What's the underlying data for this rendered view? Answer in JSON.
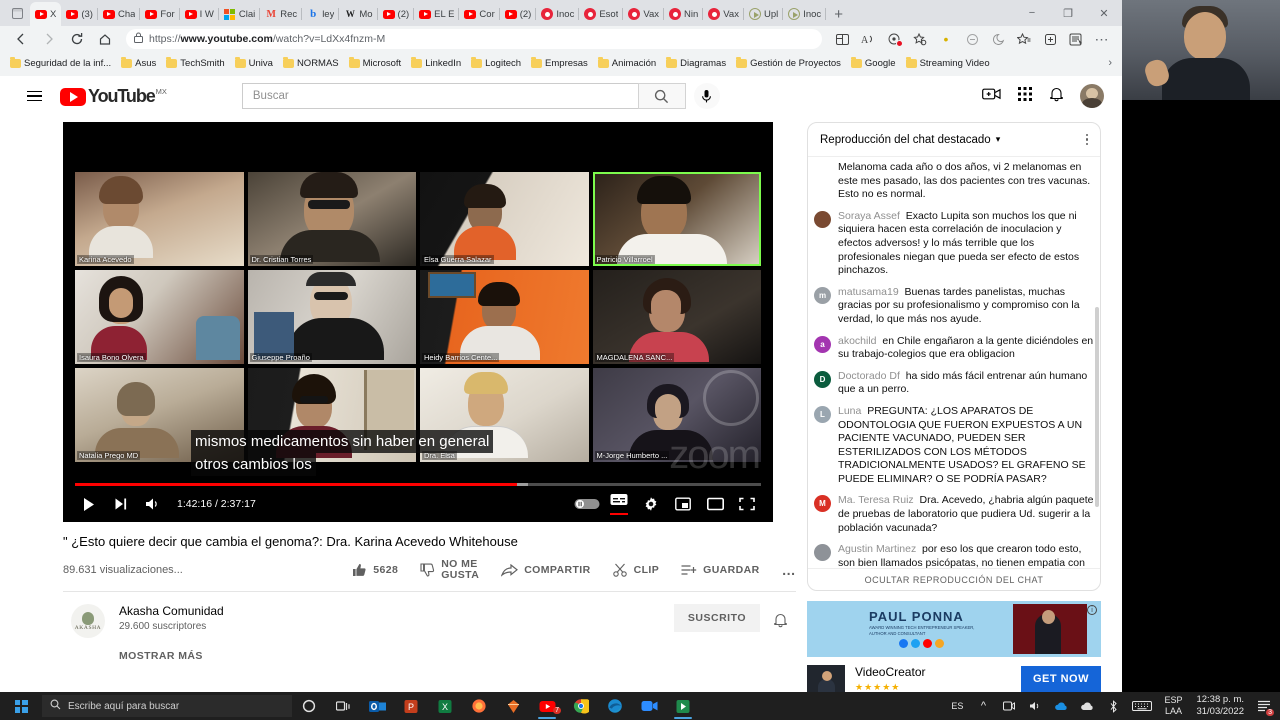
{
  "browser": {
    "tabs": [
      {
        "label": "X",
        "icon": "youtube-icon",
        "active": true
      },
      {
        "label": "(3) ",
        "icon": "youtube-icon"
      },
      {
        "label": "Cha",
        "icon": "youtube-icon"
      },
      {
        "label": "For",
        "icon": "youtube-icon"
      },
      {
        "label": "I W",
        "icon": "youtube-icon"
      },
      {
        "label": "Clai",
        "icon": "microsoft-icon"
      },
      {
        "label": "Rec",
        "icon": "gmail-icon"
      },
      {
        "label": "ley ",
        "icon": "bing-icon"
      },
      {
        "label": "Mo",
        "icon": "wikipedia-icon"
      },
      {
        "label": "(2) ",
        "icon": "youtube-icon"
      },
      {
        "label": "EL E",
        "icon": "youtube-icon"
      },
      {
        "label": "Cor",
        "icon": "youtube-icon"
      },
      {
        "label": "(2) ",
        "icon": "youtube-icon"
      },
      {
        "label": "Inoc",
        "icon": "virus-icon"
      },
      {
        "label": "Esot",
        "icon": "virus-icon"
      },
      {
        "label": "Vax",
        "icon": "virus-icon"
      },
      {
        "label": "Nin",
        "icon": "virus-icon"
      },
      {
        "label": "Vax",
        "icon": "virus-icon"
      },
      {
        "label": "Upl",
        "icon": "play-circle-icon"
      },
      {
        "label": "Inoc",
        "icon": "play-circle-icon"
      }
    ],
    "new_tab_label": "+",
    "window_controls": {
      "minimize": "−",
      "maximize": "❐",
      "close": "✕"
    },
    "url_secure": "https://",
    "url_domain": "www.youtube.com",
    "url_path": "/watch?v=LdXx4fnzm-M",
    "bookmarks": [
      "Seguridad de la inf...",
      "Asus",
      "TechSmith",
      "Univa",
      "NORMAS",
      "Microsoft",
      "LinkedIn",
      "Logitech",
      "Empresas",
      "Animación",
      "Diagramas",
      "Gestión de Proyectos",
      "Google",
      "Streaming Video"
    ],
    "bookmarks_overflow": "›"
  },
  "youtube": {
    "logo_text": "YouTube",
    "logo_country": "MX",
    "search_placeholder": "Buscar",
    "video": {
      "title": "\" ¿Esto quiere decir que cambia el genoma?: Dra. Karina Acevedo Whitehouse",
      "views": "89.631 visualizaciones...",
      "likes": "5628",
      "dislike_label_1": "NO ME",
      "dislike_label_2": "GUSTA",
      "share_label": "COMPARTIR",
      "clip_label": "CLIP",
      "save_label": "GUARDAR",
      "more_label": "…",
      "current_time": "1:42:16",
      "total_time": "2:37:17",
      "time_display": "1:42:16 / 2:37:17",
      "caption_line_1": "mismos medicamentos sin haber en general",
      "caption_line_2": "otros cambios los",
      "watermark": "zoom",
      "progress_percent": 64.5,
      "participants": [
        {
          "name": "Karina Acevedo",
          "active": false
        },
        {
          "name": "Dr. Cristian Torres",
          "active": false
        },
        {
          "name": "Elsa Guerra Salazar",
          "active": false
        },
        {
          "name": "Patricio Villarroel",
          "active": true
        },
        {
          "name": "Isaura Bono Olvera",
          "active": false
        },
        {
          "name": "Giuseppe Proaño",
          "active": false
        },
        {
          "name": "Heidy Barrios Cente...",
          "active": false
        },
        {
          "name": "MAGDALENA SANC...",
          "active": false
        },
        {
          "name": "Natalia Prego MD",
          "active": false
        },
        {
          "name": "",
          "active": false
        },
        {
          "name": "Dra. Elsa",
          "active": false
        },
        {
          "name": "M-Jorge Humberto ...",
          "active": false
        }
      ]
    },
    "channel": {
      "name": "Akasha Comunidad",
      "avatar_text": "AKASHA",
      "subscribers": "29.600 suscriptores",
      "subscribe_label": "SUSCRITO",
      "show_more_label": "MOSTRAR MÁS"
    },
    "chat": {
      "header": "Reproducción del chat destacado",
      "footer": "OCULTAR REPRODUCCIÓN DEL CHAT",
      "partial_top": "Melanoma cada año o dos años, vi 2 melanomas en este mes pasado, las dos pacientes con tres vacunas. Esto no es normal.",
      "messages": [
        {
          "author": "Soraya Assef",
          "text": "Exacto Lupita son muchos los que ni siquiera hacen esta correlación de inoculacion y efectos adversos! y lo más terrible que los profesionales niegan que pueda ser efecto de estos pinchazos.",
          "initial": "",
          "color": "#7a4a32"
        },
        {
          "author": "matusama19",
          "text": "Buenas tardes panelistas, muchas gracias por su profesionalismo y compromiso con la verdad, lo que más nos ayude.",
          "initial": "m",
          "color": "#9aa0a6"
        },
        {
          "author": "akochild",
          "text": "en Chile engañaron a la gente diciéndoles en su trabajo-colegios que era obligacion",
          "initial": "a",
          "color": "#a335b0"
        },
        {
          "author": "Doctorado Df",
          "text": "ha sido más fácil entrenar aún humano que a un perro.",
          "initial": "D",
          "color": "#0b5c3e"
        },
        {
          "author": "Luna",
          "text": "PREGUNTA: ¿LOS APARATOS DE ODONTOLOGIA QUE FUERON EXPUESTOS A UN PACIENTE VACUNADO, PUEDEN SER ESTERILIZADOS CON LOS MÉTODOS TRADICIONALMENTE USADOS? EL GRAFENO SE PUEDE ELIMINAR? O SE PODRÍA PASAR?",
          "initial": "L",
          "color": "#9aa6b0"
        },
        {
          "author": "Ma. Teresa Ruiz",
          "text": "Dra. Acevedo, ¿habria algún paquete de pruebas de laboratorio que pudiera Ud. sugerir a la población vacunada?",
          "initial": "M",
          "color": "#d93025"
        },
        {
          "author": "Agustin Martinez",
          "text": "por eso los que crearon todo esto, son bien llamados psicópatas, no tienen empatia con ninguna persona",
          "initial": "",
          "color": "#5f6368"
        }
      ]
    },
    "ad": {
      "banner_name": "PAUL PONNA",
      "banner_sub": "AWARD WINNING TECH ENTREPRENEUR SPEAKER, AUTHOR AND CONSULTANT",
      "info_label": "i",
      "product_title": "VideoCreator",
      "stars": "★★★★★",
      "cta_label": "GET NOW"
    }
  },
  "taskbar": {
    "search_placeholder": "Escribe aquí para buscar",
    "lang_line1": "ESP",
    "lang_line2": "LAA",
    "time": "12:38 p. m.",
    "date": "31/03/2022",
    "notification_count": "3",
    "ime_label": "ES"
  },
  "colors": {
    "youtube_red": "#ff0000",
    "active_speaker_green": "#7dfb4d",
    "cta_blue": "#1565d8",
    "taskbar_bg": "#1f1f1f"
  }
}
